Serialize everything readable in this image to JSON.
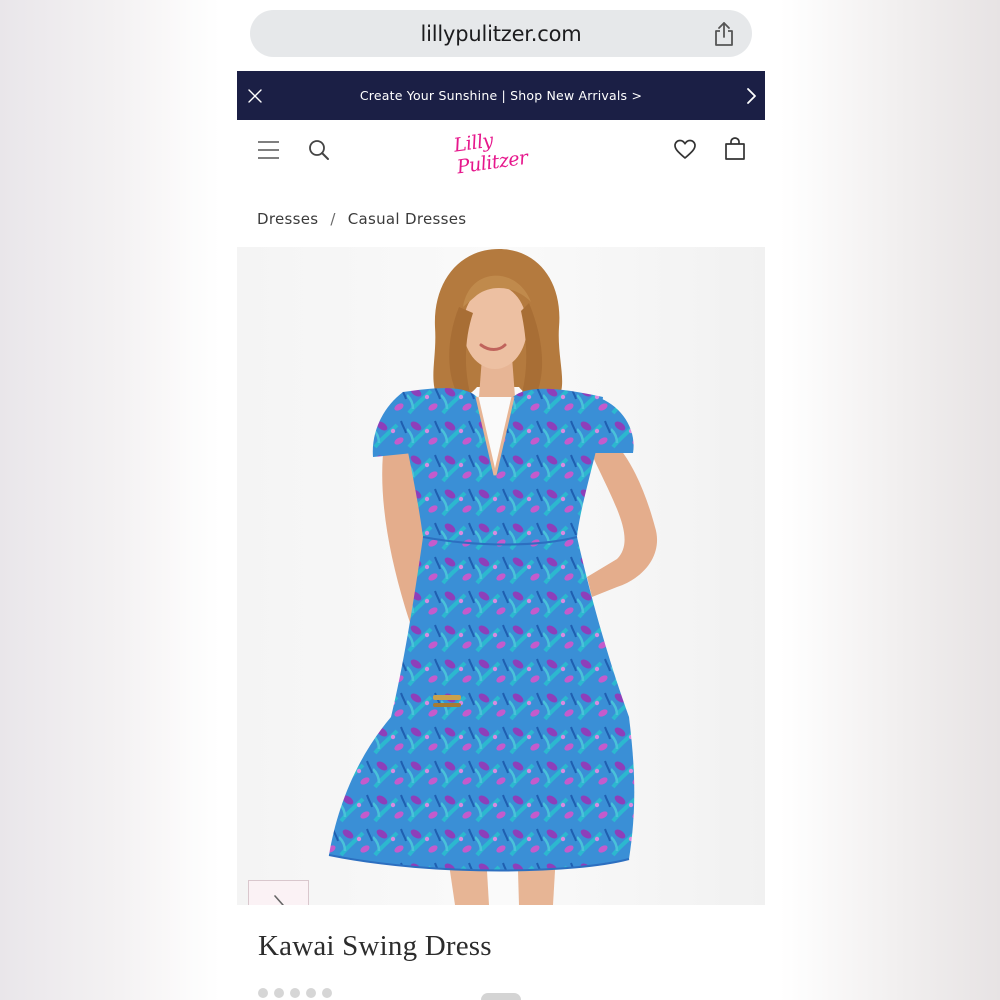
{
  "browser": {
    "url": "lillypulitzer.com",
    "share_icon": "share-icon"
  },
  "promo_banner": {
    "text": "Create Your Sunshine | Shop New Arrivals >",
    "close_icon": "close-icon",
    "next_icon": "chevron-right-icon",
    "background": "#1b1f45"
  },
  "header": {
    "logo_text": "Lilly Pulitzer",
    "brand_color": "#e6178c",
    "icons": [
      "menu-icon",
      "search-icon",
      "heart-icon",
      "bag-icon"
    ]
  },
  "breadcrumb": {
    "items": [
      "Dresses",
      "Casual Dresses"
    ],
    "separator": "/"
  },
  "product": {
    "name": "Kawai Swing Dress",
    "dress_colors": [
      "#3f8fd8",
      "#2fb6cf",
      "#8a3fb8",
      "#c255c9"
    ],
    "image_next_icon": "chevron-right-icon"
  }
}
